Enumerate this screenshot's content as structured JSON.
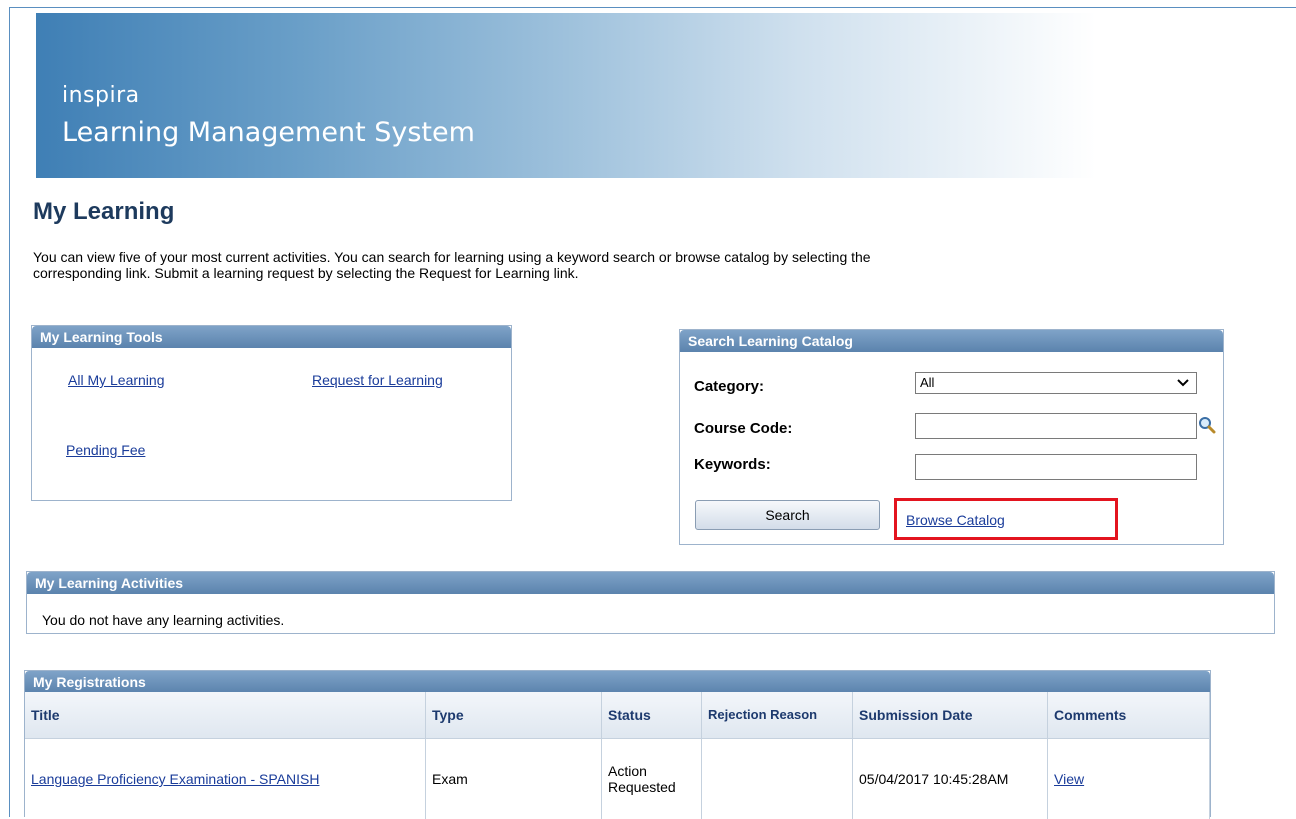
{
  "banner": {
    "line1": "inspira",
    "line2": "Learning Management System"
  },
  "page": {
    "title": "My Learning",
    "intro": "You can view five of your most current activities. You can search for learning using a keyword search or browse catalog by selecting the corresponding link. Submit a learning request by selecting the Request for Learning link."
  },
  "tools": {
    "title": "My Learning Tools",
    "links": [
      "All My Learning",
      "Request for Learning",
      "Pending Fee"
    ]
  },
  "search": {
    "title": "Search Learning Catalog",
    "category_label": "Category:",
    "category_value": "All",
    "course_code_label": "Course Code:",
    "course_code_value": "",
    "keywords_label": "Keywords:",
    "keywords_value": "",
    "search_button": "Search",
    "browse_link": "Browse Catalog",
    "highlight_color": "#e3141f"
  },
  "activities": {
    "title": "My Learning Activities",
    "message": "You do not have any learning activities."
  },
  "registrations": {
    "title": "My Registrations",
    "columns": [
      "Title",
      "Type",
      "Status",
      "Rejection Reason",
      "Submission Date",
      "Comments"
    ],
    "rows": [
      {
        "title": "Language Proficiency Examination - SPANISH",
        "type": "Exam",
        "status": "Action Requested",
        "rejection_reason": "",
        "submission_date": "05/04/2017 10:45:28AM",
        "comments": "View"
      }
    ]
  }
}
